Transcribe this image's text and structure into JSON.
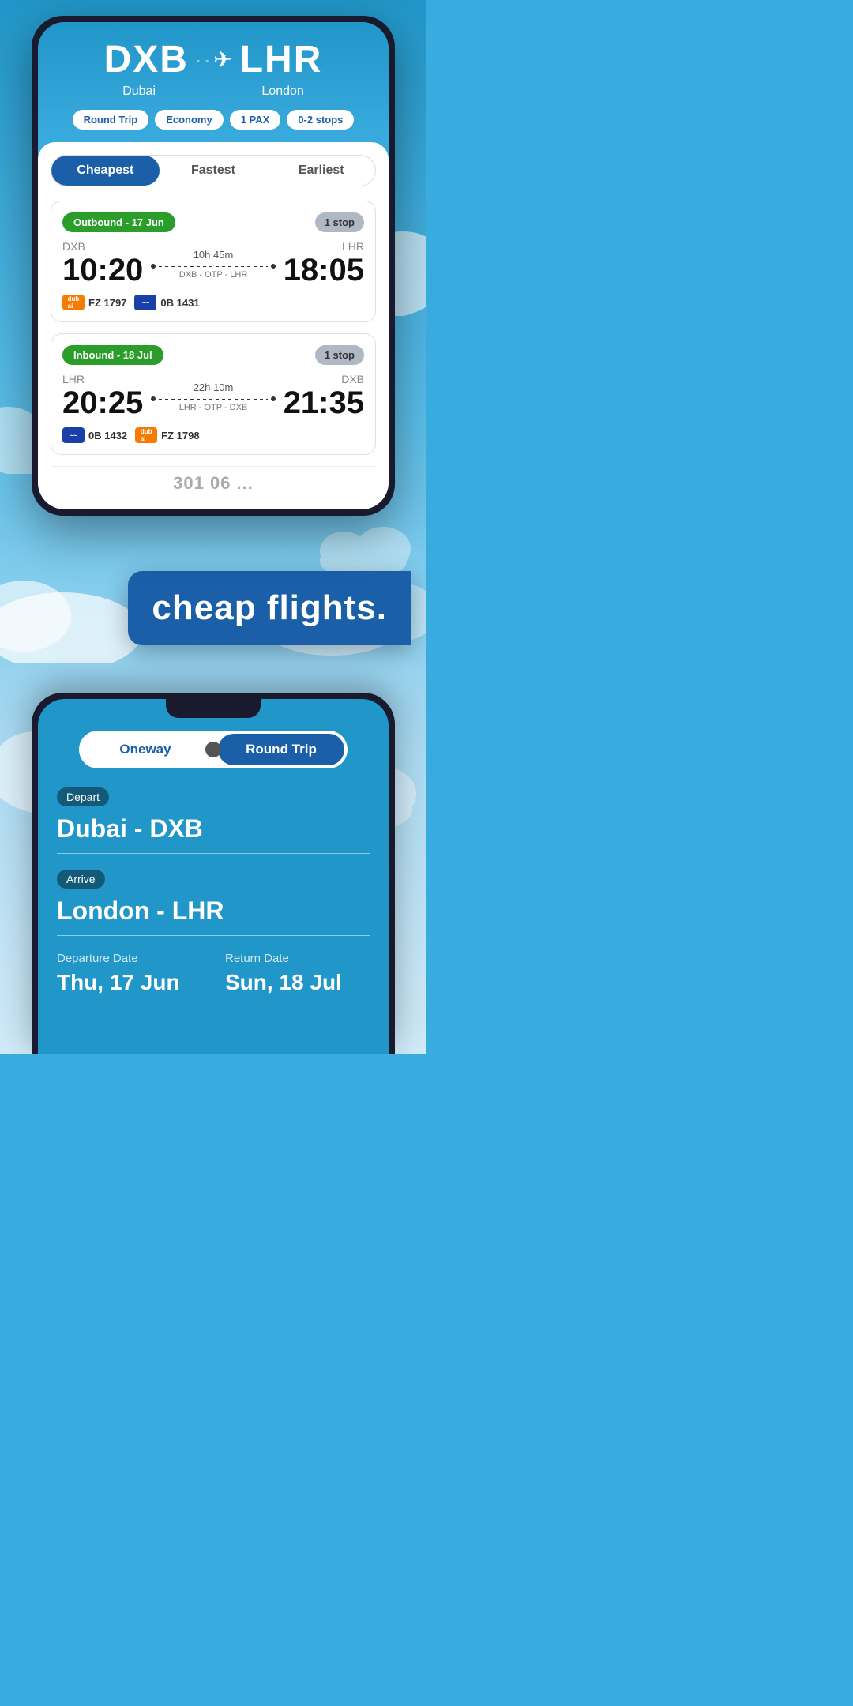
{
  "app": {
    "title": "cheap flights."
  },
  "phone1": {
    "route": {
      "from_code": "DXB",
      "from_city": "Dubai",
      "to_code": "LHR",
      "to_city": "London"
    },
    "filters": {
      "trip_type": "Round Trip",
      "cabin": "Economy",
      "pax": "1 PAX",
      "stops": "0-2 stops"
    },
    "sort_tabs": [
      {
        "label": "Cheapest",
        "active": true
      },
      {
        "label": "Fastest",
        "active": false
      },
      {
        "label": "Earliest",
        "active": false
      }
    ],
    "outbound": {
      "label": "Outbound - 17 Jun",
      "stops_badge": "1 stop",
      "from": "DXB",
      "to": "LHR",
      "depart_time": "10:20",
      "arrive_time": "18:05",
      "duration": "10h 45m",
      "via": "DXB - OTP - LHR",
      "airlines": [
        {
          "code": "FZ 1797",
          "color": "orange"
        },
        {
          "code": "0B 1431",
          "color": "blue"
        }
      ]
    },
    "inbound": {
      "label": "Inbound - 18 Jul",
      "stops_badge": "1 stop",
      "from": "LHR",
      "to": "DXB",
      "depart_time": "20:25",
      "arrive_time": "21:35",
      "duration": "22h 10m",
      "via": "LHR - OTP - DXB",
      "airlines": [
        {
          "code": "0B 1432",
          "color": "blue"
        },
        {
          "code": "FZ 1798",
          "color": "orange"
        }
      ]
    }
  },
  "phone2": {
    "trip_toggle": {
      "options": [
        "Oneway",
        "Round Trip"
      ],
      "active": "Round Trip"
    },
    "depart": {
      "label": "Depart",
      "value": "Dubai - DXB"
    },
    "arrive": {
      "label": "Arrive",
      "value": "London - LHR"
    },
    "departure_date": {
      "label": "Departure Date",
      "value": "Thu, 17 Jun"
    },
    "return_date": {
      "label": "Return Date",
      "value": "Sun, 18 Jul"
    }
  }
}
